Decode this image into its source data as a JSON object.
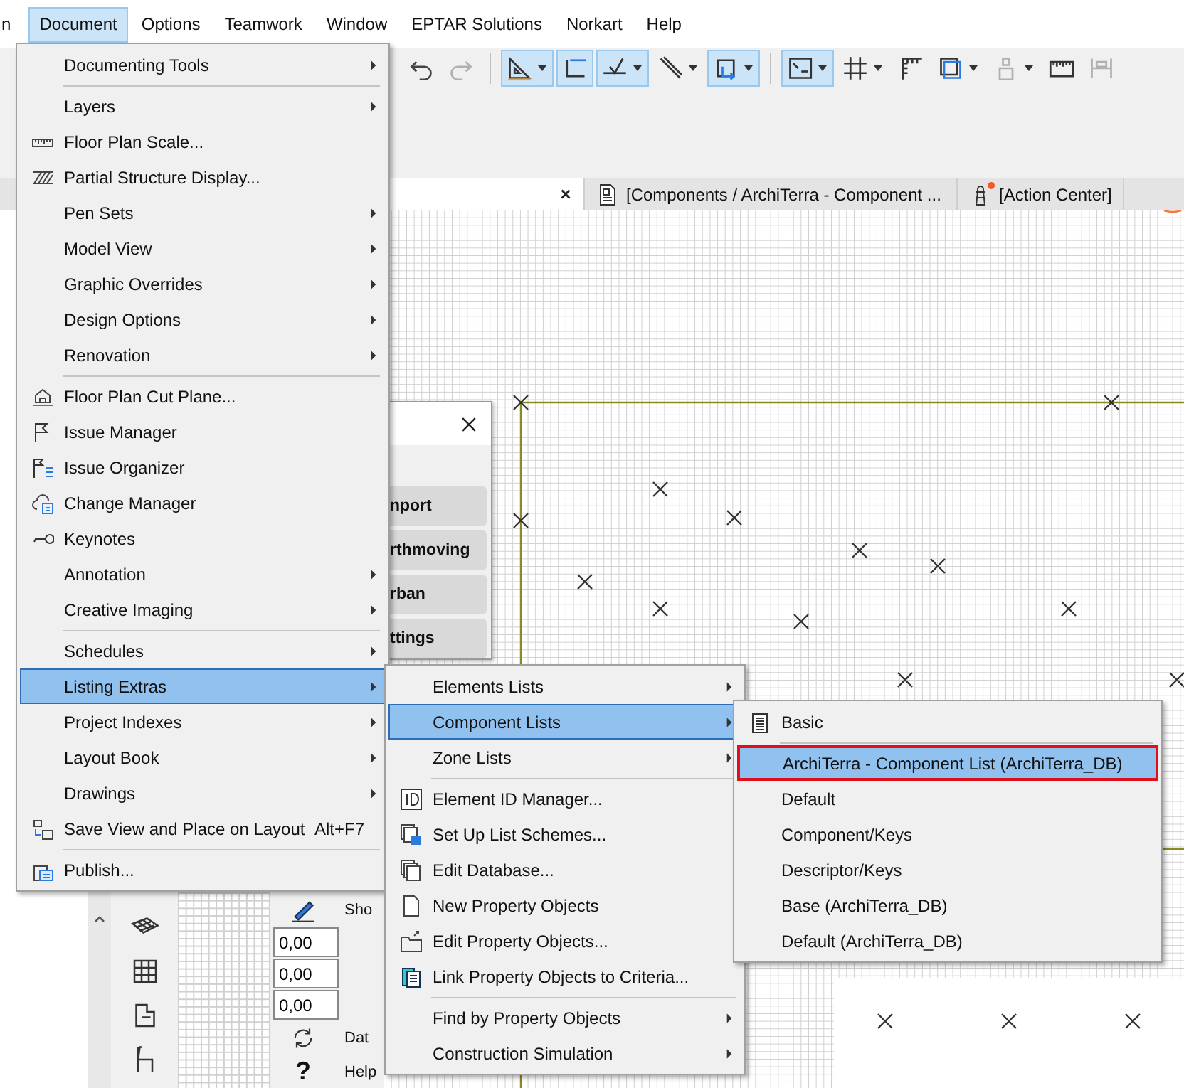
{
  "menu_bar": [
    {
      "label": "n",
      "selected": false
    },
    {
      "label": "Document",
      "selected": true
    },
    {
      "label": "Options",
      "selected": false
    },
    {
      "label": "Teamwork",
      "selected": false
    },
    {
      "label": "Window",
      "selected": false
    },
    {
      "label": "EPTAR Solutions",
      "selected": false
    },
    {
      "label": "Norkart",
      "selected": false
    },
    {
      "label": "Help",
      "selected": false
    }
  ],
  "toolbar": [
    {
      "pressed": false,
      "disabled": false
    },
    {
      "pressed": false,
      "disabled": true
    },
    {
      "pressed": true,
      "disabled": false
    },
    {
      "pressed": true,
      "disabled": false
    },
    {
      "pressed": true,
      "disabled": false
    },
    {
      "pressed": false,
      "disabled": false
    },
    {
      "pressed": true,
      "disabled": false
    },
    {
      "pressed": true,
      "disabled": false
    },
    {
      "pressed": false,
      "disabled": false
    },
    {
      "pressed": false,
      "disabled": false
    },
    {
      "pressed": false,
      "disabled": false
    },
    {
      "pressed": false,
      "disabled": true
    },
    {
      "pressed": false,
      "disabled": false
    },
    {
      "pressed": false,
      "disabled": true
    }
  ],
  "tabs": [
    {
      "selected": true,
      "alert": false
    },
    {
      "label": "[Components / ArchiTerra - Component ...",
      "selected": false,
      "alert": false
    },
    {
      "label": "[Action Center]",
      "selected": false,
      "alert": true
    }
  ],
  "palette": {
    "buttons": [
      "nport",
      "rthmoving",
      "rban",
      "ttings"
    ]
  },
  "info_box": {
    "labels": [
      "Sho",
      "Dat",
      "Help"
    ],
    "fields": [
      "0,00",
      "0,00",
      "0,00"
    ],
    "help_glyph": "?"
  },
  "menus": [
    {
      "items": [
        {
          "kind": "item",
          "label": "Documenting Tools",
          "submenu": true,
          "selected": false
        },
        {
          "kind": "separator"
        },
        {
          "kind": "item",
          "label": "Layers",
          "submenu": true,
          "selected": false
        },
        {
          "kind": "item",
          "label": "Floor Plan Scale...",
          "submenu": false,
          "selected": false
        },
        {
          "kind": "item",
          "label": "Partial Structure Display...",
          "submenu": false,
          "selected": false
        },
        {
          "kind": "item",
          "label": "Pen Sets",
          "submenu": true,
          "selected": false
        },
        {
          "kind": "item",
          "label": "Model View",
          "submenu": true,
          "selected": false
        },
        {
          "kind": "item",
          "label": "Graphic Overrides",
          "submenu": true,
          "selected": false
        },
        {
          "kind": "item",
          "label": "Design Options",
          "submenu": true,
          "selected": false
        },
        {
          "kind": "item",
          "label": "Renovation",
          "submenu": true,
          "selected": false
        },
        {
          "kind": "separator"
        },
        {
          "kind": "item",
          "label": "Floor Plan Cut Plane...",
          "submenu": false,
          "selected": false
        },
        {
          "kind": "item",
          "label": "Issue Manager",
          "submenu": false,
          "selected": false
        },
        {
          "kind": "item",
          "label": "Issue Organizer",
          "submenu": false,
          "selected": false
        },
        {
          "kind": "item",
          "label": "Change Manager",
          "submenu": false,
          "selected": false
        },
        {
          "kind": "item",
          "label": "Keynotes",
          "submenu": false,
          "selected": false
        },
        {
          "kind": "item",
          "label": "Annotation",
          "submenu": true,
          "selected": false
        },
        {
          "kind": "item",
          "label": "Creative Imaging",
          "submenu": true,
          "selected": false
        },
        {
          "kind": "separator"
        },
        {
          "kind": "item",
          "label": "Schedules",
          "submenu": true,
          "selected": false
        },
        {
          "kind": "item",
          "label": "Listing Extras",
          "submenu": true,
          "selected": true
        },
        {
          "kind": "item",
          "label": "Project Indexes",
          "submenu": true,
          "selected": false
        },
        {
          "kind": "item",
          "label": "Layout Book",
          "submenu": true,
          "selected": false
        },
        {
          "kind": "item",
          "label": "Drawings",
          "submenu": true,
          "selected": false
        },
        {
          "kind": "item",
          "label": "Save View and Place on Layout",
          "shortcut": "Alt+F7",
          "submenu": false,
          "selected": false
        },
        {
          "kind": "separator"
        },
        {
          "kind": "item",
          "label": "Publish...",
          "submenu": false,
          "selected": false
        }
      ]
    },
    {
      "items": [
        {
          "kind": "item",
          "label": "Elements Lists",
          "submenu": true,
          "selected": false
        },
        {
          "kind": "item",
          "label": "Component Lists",
          "submenu": true,
          "selected": true
        },
        {
          "kind": "item",
          "label": "Zone Lists",
          "submenu": true,
          "selected": false
        },
        {
          "kind": "separator"
        },
        {
          "kind": "item",
          "label": "Element ID Manager...",
          "submenu": false,
          "selected": false
        },
        {
          "kind": "item",
          "label": "Set Up List Schemes...",
          "submenu": false,
          "selected": false
        },
        {
          "kind": "item",
          "label": "Edit Database...",
          "submenu": false,
          "selected": false
        },
        {
          "kind": "item",
          "label": "New Property Objects",
          "submenu": false,
          "selected": false
        },
        {
          "kind": "item",
          "label": "Edit Property Objects...",
          "submenu": false,
          "selected": false
        },
        {
          "kind": "item",
          "label": "Link Property Objects to Criteria...",
          "submenu": false,
          "selected": false
        },
        {
          "kind": "separator"
        },
        {
          "kind": "item",
          "label": "Find by Property Objects",
          "submenu": true,
          "selected": false
        },
        {
          "kind": "item",
          "label": "Construction Simulation",
          "submenu": true,
          "selected": false
        }
      ]
    },
    {
      "items": [
        {
          "kind": "item",
          "label": "Basic",
          "submenu": false,
          "selected": false,
          "outlined": false
        },
        {
          "kind": "separator"
        },
        {
          "kind": "item",
          "label": "ArchiTerra - Component List (ArchiTerra_DB)",
          "submenu": false,
          "selected": true,
          "outlined": true
        },
        {
          "kind": "item",
          "label": "Default",
          "submenu": false,
          "selected": false,
          "outlined": false
        },
        {
          "kind": "item",
          "label": "Component/Keys",
          "submenu": false,
          "selected": false,
          "outlined": false
        },
        {
          "kind": "item",
          "label": "Descriptor/Keys",
          "submenu": false,
          "selected": false,
          "outlined": false
        },
        {
          "kind": "item",
          "label": "Base (ArchiTerra_DB)",
          "submenu": false,
          "selected": false,
          "outlined": false
        },
        {
          "kind": "item",
          "label": "Default (ArchiTerra_DB)",
          "submenu": false,
          "selected": false,
          "outlined": false
        }
      ]
    }
  ]
}
